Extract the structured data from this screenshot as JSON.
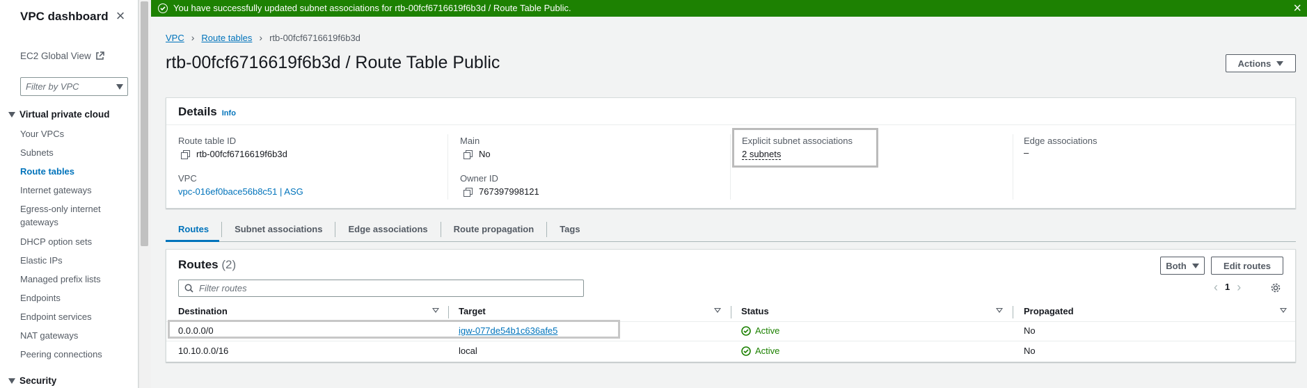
{
  "sidebar": {
    "title": "VPC dashboard",
    "ec2_global_view": "EC2 Global View",
    "filter_placeholder": "Filter by VPC",
    "section_vpc": "Virtual private cloud",
    "items": [
      "Your VPCs",
      "Subnets",
      "Route tables",
      "Internet gateways",
      "Egress-only internet gateways",
      "DHCP option sets",
      "Elastic IPs",
      "Managed prefix lists",
      "Endpoints",
      "Endpoint services",
      "NAT gateways",
      "Peering connections"
    ],
    "active_item": "Route tables",
    "section_security": "Security"
  },
  "banner": {
    "message": "You have successfully updated subnet associations for rtb-00fcf6716619f6b3d / Route Table Public.",
    "color": "#1d8102"
  },
  "breadcrumb": [
    "VPC",
    "Route tables",
    "rtb-00fcf6716619f6b3d"
  ],
  "page": {
    "title": "rtb-00fcf6716619f6b3d / Route Table Public",
    "actions_label": "Actions"
  },
  "details": {
    "heading": "Details",
    "info": "Info",
    "route_table_id_label": "Route table ID",
    "route_table_id": "rtb-00fcf6716619f6b3d",
    "main_label": "Main",
    "main_value": "No",
    "explicit_label": "Explicit subnet associations",
    "explicit_value": "2 subnets",
    "edge_label": "Edge associations",
    "edge_value": "–",
    "vpc_label": "VPC",
    "vpc_value": "vpc-016ef0bace56b8c51 | ASG",
    "owner_label": "Owner ID",
    "owner_value": "767397998121"
  },
  "tabs": [
    "Routes",
    "Subnet associations",
    "Edge associations",
    "Route propagation",
    "Tags"
  ],
  "routes": {
    "heading": "Routes",
    "count": "(2)",
    "both_label": "Both",
    "edit_label": "Edit routes",
    "filter_placeholder": "Filter routes",
    "page": "1",
    "columns": [
      "Destination",
      "Target",
      "Status",
      "Propagated"
    ],
    "rows": [
      {
        "destination": "0.0.0.0/0",
        "target": "igw-077de54b1c636afe5",
        "status": "Active",
        "propagated": "No"
      },
      {
        "destination": "10.10.0.0/16",
        "target": "local",
        "status": "Active",
        "propagated": "No"
      }
    ]
  },
  "colors": {
    "accent": "#0073bb",
    "success": "#1d8102"
  }
}
